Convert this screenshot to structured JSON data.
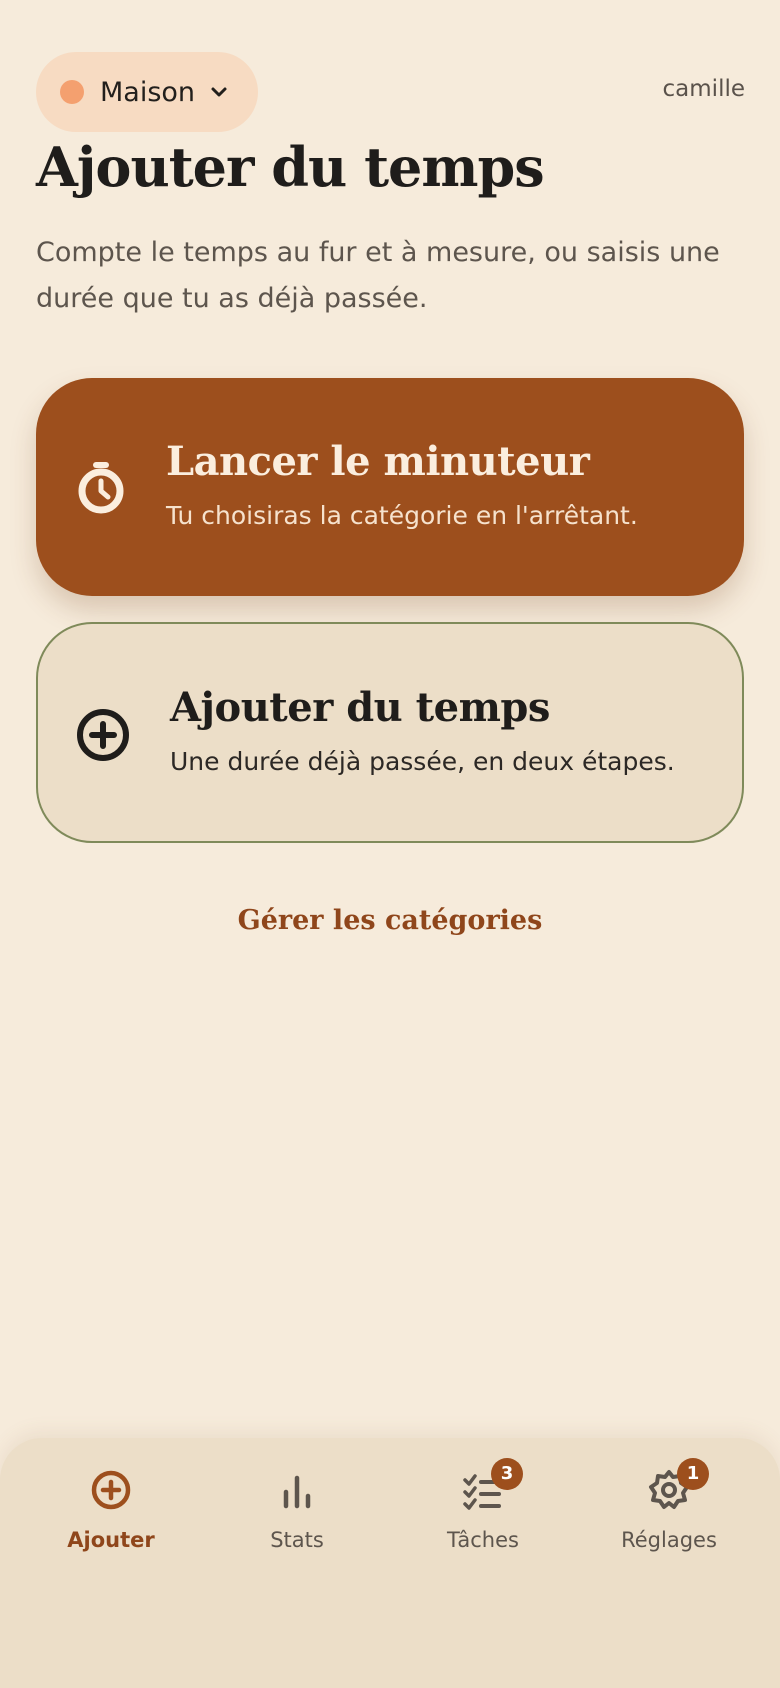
{
  "header": {
    "workspace": "Maison",
    "user": "camille"
  },
  "page": {
    "title": "Ajouter du temps",
    "subtitle": "Compte le temps au fur et à mesure, ou saisis une durée que tu as déjà passée."
  },
  "cards": {
    "timer": {
      "title": "Lancer le minuteur",
      "description": "Tu choisiras la catégorie en l'arrêtant.",
      "icon": "stopwatch-icon"
    },
    "manual": {
      "title": "Ajouter du temps",
      "description": "Une durée déjà passée, en deux étapes.",
      "icon": "plus-circle-icon"
    }
  },
  "links": {
    "manage_categories": "Gérer les catégories"
  },
  "nav": {
    "items": [
      {
        "label": "Ajouter",
        "icon": "plus-circle-icon",
        "active": true
      },
      {
        "label": "Stats",
        "icon": "bar-chart-icon"
      },
      {
        "label": "Tâches",
        "icon": "task-list-icon",
        "badge": "3"
      },
      {
        "label": "Réglages",
        "icon": "settings-gear-icon",
        "badge": "1"
      }
    ]
  },
  "colors": {
    "background": "#f6ebdb",
    "accent": "#9d4f1d",
    "workspace_dot": "#f4a06f",
    "card_border": "#7f8a5a"
  }
}
